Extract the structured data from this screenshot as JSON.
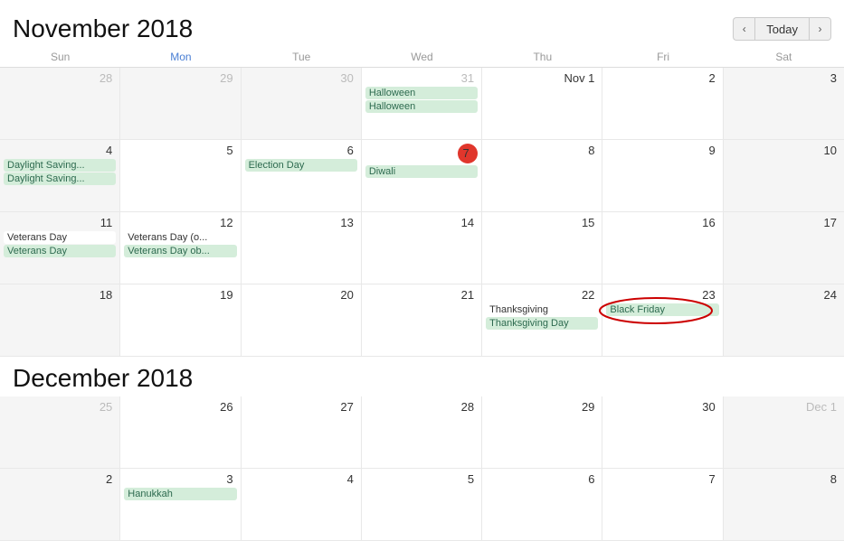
{
  "header": {
    "title": "November 2018",
    "nav": {
      "prev": "‹",
      "today": "Today",
      "next": "›"
    }
  },
  "dayHeaders": [
    "Sun",
    "Mon",
    "Tue",
    "Wed",
    "Thu",
    "Fri",
    "Sat"
  ],
  "november": {
    "weeks": [
      [
        {
          "num": "28",
          "month": "other"
        },
        {
          "num": "29",
          "month": "other"
        },
        {
          "num": "30",
          "month": "other"
        },
        {
          "num": "31",
          "month": "other",
          "events": [
            {
              "label": "Halloween",
              "style": "green"
            },
            {
              "label": "Halloween",
              "style": "green"
            }
          ]
        },
        {
          "num": "Nov 1",
          "month": "current"
        },
        {
          "num": "2",
          "month": "current"
        },
        {
          "num": "3",
          "month": "current"
        }
      ],
      [
        {
          "num": "4",
          "month": "current",
          "events": [
            {
              "label": "Daylight Saving...",
              "style": "green"
            },
            {
              "label": "Daylight Saving...",
              "style": "green"
            }
          ]
        },
        {
          "num": "5",
          "month": "current"
        },
        {
          "num": "6",
          "month": "current",
          "events": [
            {
              "label": "Election Day",
              "style": "green"
            }
          ]
        },
        {
          "num": "7",
          "month": "current",
          "today": true,
          "events": [
            {
              "label": "Diwali",
              "style": "green"
            }
          ]
        },
        {
          "num": "8",
          "month": "current"
        },
        {
          "num": "9",
          "month": "current"
        },
        {
          "num": "10",
          "month": "current"
        }
      ],
      [
        {
          "num": "11",
          "month": "current",
          "events": [
            {
              "label": "Veterans Day",
              "style": "white"
            },
            {
              "label": "Veterans Day",
              "style": "green"
            }
          ]
        },
        {
          "num": "12",
          "month": "current",
          "events": [
            {
              "label": "Veterans Day (o...",
              "style": "white"
            },
            {
              "label": "Veterans Day ob...",
              "style": "green"
            }
          ]
        },
        {
          "num": "13",
          "month": "current"
        },
        {
          "num": "14",
          "month": "current"
        },
        {
          "num": "15",
          "month": "current"
        },
        {
          "num": "16",
          "month": "current"
        },
        {
          "num": "17",
          "month": "current"
        }
      ],
      [
        {
          "num": "18",
          "month": "current"
        },
        {
          "num": "19",
          "month": "current"
        },
        {
          "num": "20",
          "month": "current"
        },
        {
          "num": "21",
          "month": "current"
        },
        {
          "num": "22",
          "month": "current",
          "events": [
            {
              "label": "Thanksgiving",
              "style": "white"
            },
            {
              "label": "Thanksgiving Day",
              "style": "green"
            }
          ]
        },
        {
          "num": "23",
          "month": "current",
          "events": [
            {
              "label": "Black Friday",
              "style": "green",
              "highlighted": true
            }
          ]
        },
        {
          "num": "24",
          "month": "current"
        }
      ]
    ]
  },
  "december": {
    "title": "December 2018",
    "weeks": [
      [
        {
          "num": "25",
          "month": "other"
        },
        {
          "num": "26",
          "month": "current"
        },
        {
          "num": "27",
          "month": "current"
        },
        {
          "num": "28",
          "month": "current"
        },
        {
          "num": "29",
          "month": "current"
        },
        {
          "num": "30",
          "month": "current"
        },
        {
          "num": "Dec 1",
          "month": "other"
        }
      ],
      [
        {
          "num": "2",
          "month": "current"
        },
        {
          "num": "3",
          "month": "current",
          "events": [
            {
              "label": "Hanukkah",
              "style": "green"
            }
          ]
        },
        {
          "num": "4",
          "month": "current"
        },
        {
          "num": "5",
          "month": "current"
        },
        {
          "num": "6",
          "month": "current"
        },
        {
          "num": "7",
          "month": "current"
        },
        {
          "num": "8",
          "month": "current"
        }
      ]
    ]
  }
}
